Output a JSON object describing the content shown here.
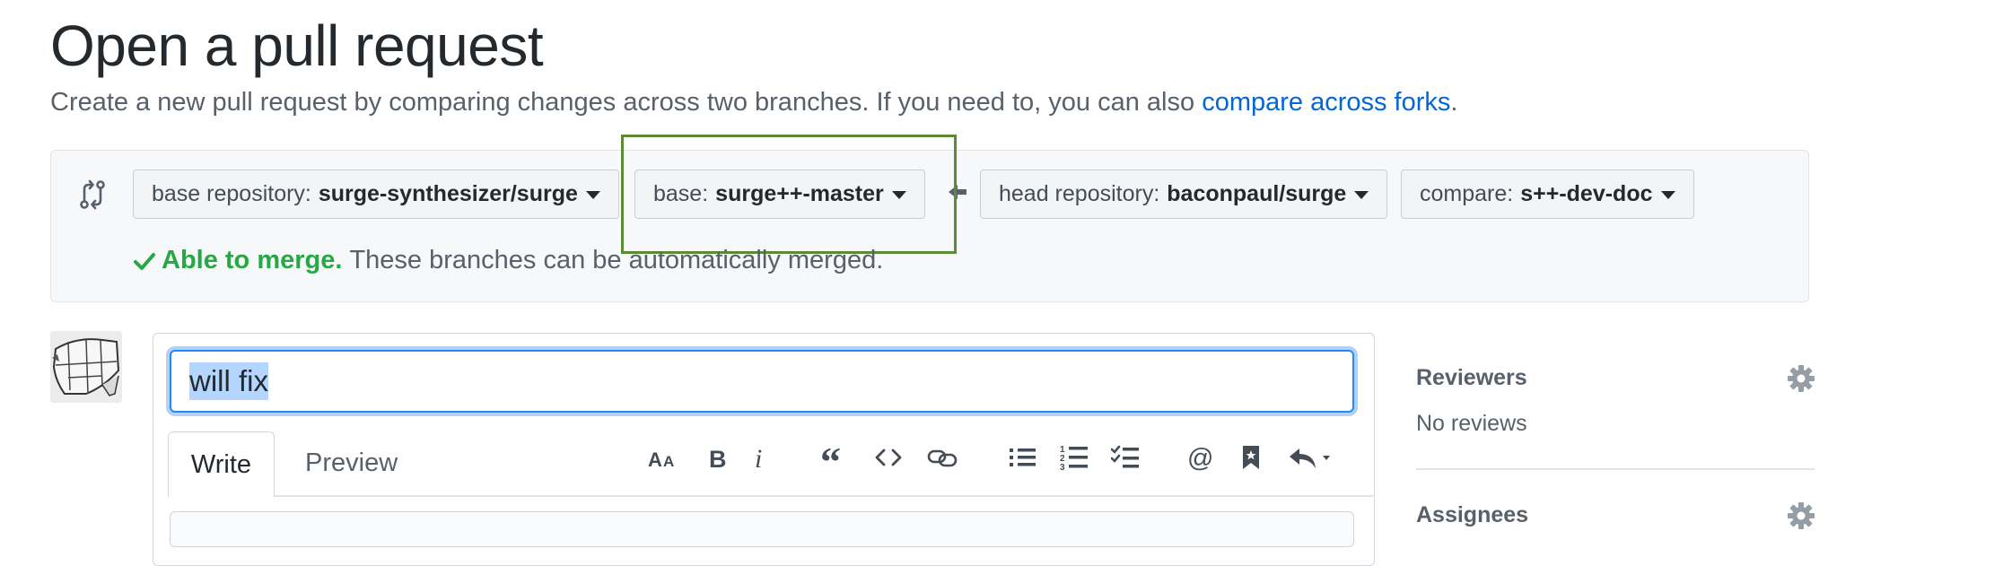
{
  "page": {
    "title": "Open a pull request",
    "subtitle_text": "Create a new pull request by comparing changes across two branches. If you need to, you can also",
    "subtitle_link": "compare across forks",
    "subtitle_end": "."
  },
  "compare": {
    "base_repo_label": "base repository:",
    "base_repo_value": "surge-synthesizer/surge",
    "base_label": "base:",
    "base_value": "surge++-master",
    "head_repo_label": "head repository:",
    "head_repo_value": "baconpaul/surge",
    "compare_label": "compare:",
    "compare_value": "s++-dev-doc"
  },
  "merge_status": {
    "status": "Able to merge.",
    "message": "These branches can be automatically merged."
  },
  "form": {
    "title_value": "will fix",
    "tabs": [
      "Write",
      "Preview"
    ],
    "toolbar_icons": [
      "text-size-icon",
      "bold-icon",
      "italic-icon",
      "quote-icon",
      "code-icon",
      "link-icon",
      "unordered-list-icon",
      "ordered-list-icon",
      "task-list-icon",
      "mention-icon",
      "bookmark-icon",
      "reply-icon"
    ]
  },
  "sidebar": {
    "reviewers_heading": "Reviewers",
    "reviewers_value": "No reviews",
    "assignees_heading": "Assignees"
  },
  "colors": {
    "link": "#0366d6",
    "success": "#28a745",
    "focus": "#2188ff",
    "highlight_box": "#5d8a34"
  }
}
